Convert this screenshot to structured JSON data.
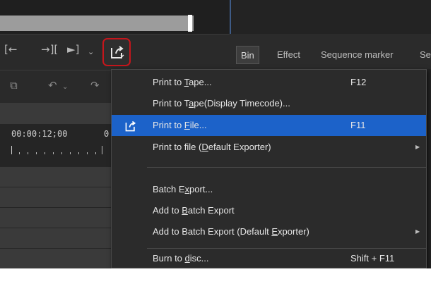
{
  "window": {
    "tabs": [
      {
        "label": "Bin",
        "active": true
      },
      {
        "label": "Effect",
        "active": false
      },
      {
        "label": "Sequence marker",
        "active": false
      },
      {
        "label": "Se",
        "active": false
      }
    ],
    "timeline": {
      "timecode": "00:00:12;00",
      "timecode_next": "0"
    }
  },
  "menu": {
    "items": [
      {
        "label_pre": "Print to ",
        "label_key": "T",
        "label_post": "ape...",
        "shortcut": "F12",
        "highlighted": false,
        "submenu": false
      },
      {
        "label_pre": "Print to T",
        "label_key": "a",
        "label_post": "pe(Display Timecode)...",
        "shortcut": "",
        "highlighted": false,
        "submenu": false
      },
      {
        "label_pre": "Print to ",
        "label_key": "F",
        "label_post": "ile...",
        "shortcut": "F11",
        "highlighted": true,
        "submenu": false
      },
      {
        "label_pre": "Print to file (",
        "label_key": "D",
        "label_post": "efault Exporter)",
        "shortcut": "",
        "highlighted": false,
        "submenu": true
      },
      {
        "label_pre": "Batch E",
        "label_key": "x",
        "label_post": "port...",
        "shortcut": "",
        "highlighted": false,
        "submenu": false
      },
      {
        "label_pre": "Add to ",
        "label_key": "B",
        "label_post": "atch Export",
        "shortcut": "",
        "highlighted": false,
        "submenu": false
      },
      {
        "label_pre": "Add to Batch Export (Default ",
        "label_key": "E",
        "label_post": "xporter)",
        "shortcut": "",
        "highlighted": false,
        "submenu": true
      },
      {
        "label_pre": "Burn to ",
        "label_key": "d",
        "label_post": "isc...",
        "shortcut": "Shift + F11",
        "highlighted": false,
        "submenu": false
      }
    ]
  },
  "colors": {
    "highlight": "#1c62c9",
    "focus_outline": "#c4161c",
    "menu_bg": "#2b2b2b"
  },
  "icons": [
    "export-icon",
    "in-point-icon",
    "out-point-icon",
    "undo-icon",
    "redo-icon"
  ]
}
